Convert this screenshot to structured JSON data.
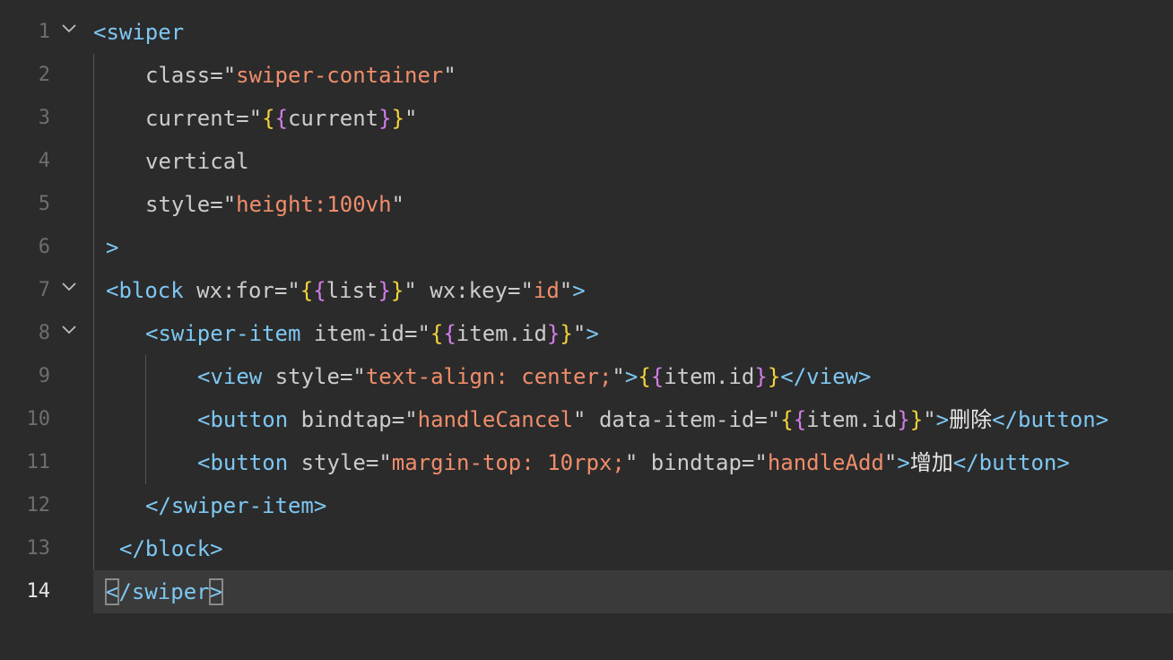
{
  "editor": {
    "active_line": 14,
    "lines": [
      {
        "no": "1",
        "tokens": [
          {
            "t": "<swiper",
            "c": "tag"
          }
        ]
      },
      {
        "no": "2",
        "tokens": [
          {
            "t": "class",
            "c": "attr"
          },
          {
            "t": "=",
            "c": "eq"
          },
          {
            "t": "\"",
            "c": "quote"
          },
          {
            "t": "swiper-container",
            "c": "str"
          },
          {
            "t": "\"",
            "c": "quote"
          }
        ]
      },
      {
        "no": "3",
        "tokens": [
          {
            "t": "current",
            "c": "attr"
          },
          {
            "t": "=",
            "c": "eq"
          },
          {
            "t": "\"",
            "c": "quote"
          },
          {
            "t": "{",
            "c": "brace-y"
          },
          {
            "t": "{",
            "c": "brace-p"
          },
          {
            "t": "current",
            "c": "var"
          },
          {
            "t": "}",
            "c": "brace-p"
          },
          {
            "t": "}",
            "c": "brace-y"
          },
          {
            "t": "\"",
            "c": "quote"
          }
        ]
      },
      {
        "no": "4",
        "tokens": [
          {
            "t": "vertical",
            "c": "attr"
          }
        ]
      },
      {
        "no": "5",
        "tokens": [
          {
            "t": "style",
            "c": "attr"
          },
          {
            "t": "=",
            "c": "eq"
          },
          {
            "t": "\"",
            "c": "quote"
          },
          {
            "t": "height:100vh",
            "c": "str"
          },
          {
            "t": "\"",
            "c": "quote"
          }
        ]
      },
      {
        "no": "6",
        "tokens": [
          {
            "t": ">",
            "c": "tag"
          }
        ]
      },
      {
        "no": "7",
        "tokens": [
          {
            "t": "<block",
            "c": "tag"
          },
          {
            "t": " wx:for",
            "c": "attr"
          },
          {
            "t": "=",
            "c": "eq"
          },
          {
            "t": "\"",
            "c": "quote"
          },
          {
            "t": "{",
            "c": "brace-y"
          },
          {
            "t": "{",
            "c": "brace-p"
          },
          {
            "t": "list",
            "c": "var"
          },
          {
            "t": "}",
            "c": "brace-p"
          },
          {
            "t": "}",
            "c": "brace-y"
          },
          {
            "t": "\"",
            "c": "quote"
          },
          {
            "t": " wx:key",
            "c": "attr"
          },
          {
            "t": "=",
            "c": "eq"
          },
          {
            "t": "\"",
            "c": "quote"
          },
          {
            "t": "id",
            "c": "str"
          },
          {
            "t": "\"",
            "c": "quote"
          },
          {
            "t": ">",
            "c": "tag"
          }
        ]
      },
      {
        "no": "8",
        "tokens": [
          {
            "t": "<swiper-item",
            "c": "tag"
          },
          {
            "t": " item-id",
            "c": "attr"
          },
          {
            "t": "=",
            "c": "eq"
          },
          {
            "t": "\"",
            "c": "quote"
          },
          {
            "t": "{",
            "c": "brace-y"
          },
          {
            "t": "{",
            "c": "brace-p"
          },
          {
            "t": "item.id",
            "c": "var"
          },
          {
            "t": "}",
            "c": "brace-p"
          },
          {
            "t": "}",
            "c": "brace-y"
          },
          {
            "t": "\"",
            "c": "quote"
          },
          {
            "t": ">",
            "c": "tag"
          }
        ]
      },
      {
        "no": "9",
        "tokens": [
          {
            "t": "<view",
            "c": "tag"
          },
          {
            "t": " style",
            "c": "attr"
          },
          {
            "t": "=",
            "c": "eq"
          },
          {
            "t": "\"",
            "c": "quote"
          },
          {
            "t": "text-align: center;",
            "c": "str"
          },
          {
            "t": "\"",
            "c": "quote"
          },
          {
            "t": ">",
            "c": "tag"
          },
          {
            "t": "{",
            "c": "brace-y"
          },
          {
            "t": "{",
            "c": "brace-p"
          },
          {
            "t": "item.id",
            "c": "var"
          },
          {
            "t": "}",
            "c": "brace-p"
          },
          {
            "t": "}",
            "c": "brace-y"
          },
          {
            "t": "</view>",
            "c": "tag"
          }
        ]
      },
      {
        "no": "10",
        "tokens": [
          {
            "t": "<button",
            "c": "tag"
          },
          {
            "t": " bindtap",
            "c": "attr"
          },
          {
            "t": "=",
            "c": "eq"
          },
          {
            "t": "\"",
            "c": "quote"
          },
          {
            "t": "handleCancel",
            "c": "str"
          },
          {
            "t": "\"",
            "c": "quote"
          },
          {
            "t": " data-item-id",
            "c": "attr"
          },
          {
            "t": "=",
            "c": "eq"
          },
          {
            "t": "\"",
            "c": "quote"
          },
          {
            "t": "{",
            "c": "brace-y"
          },
          {
            "t": "{",
            "c": "brace-p"
          },
          {
            "t": "item.id",
            "c": "var"
          },
          {
            "t": "}",
            "c": "brace-p"
          },
          {
            "t": "}",
            "c": "brace-y"
          },
          {
            "t": "\"",
            "c": "quote"
          },
          {
            "t": ">",
            "c": "tag"
          },
          {
            "t": "删除",
            "c": "text"
          },
          {
            "t": "</button>",
            "c": "tag"
          }
        ]
      },
      {
        "no": "11",
        "tokens": [
          {
            "t": "<button",
            "c": "tag"
          },
          {
            "t": " style",
            "c": "attr"
          },
          {
            "t": "=",
            "c": "eq"
          },
          {
            "t": "\"",
            "c": "quote"
          },
          {
            "t": "margin-top: 10rpx;",
            "c": "str"
          },
          {
            "t": "\"",
            "c": "quote"
          },
          {
            "t": " bindtap",
            "c": "attr"
          },
          {
            "t": "=",
            "c": "eq"
          },
          {
            "t": "\"",
            "c": "quote"
          },
          {
            "t": "handleAdd",
            "c": "str"
          },
          {
            "t": "\"",
            "c": "quote"
          },
          {
            "t": ">",
            "c": "tag"
          },
          {
            "t": "增加",
            "c": "text"
          },
          {
            "t": "</button>",
            "c": "tag"
          }
        ]
      },
      {
        "no": "12",
        "tokens": [
          {
            "t": "</swiper-item>",
            "c": "tag"
          }
        ]
      },
      {
        "no": "13",
        "tokens": [
          {
            "t": "</block>",
            "c": "tag"
          }
        ]
      },
      {
        "no": "14",
        "tokens": [
          {
            "t": "<",
            "c": "tag bracket-box"
          },
          {
            "t": "/swiper",
            "c": "tag"
          },
          {
            "t": ">",
            "c": "tag bracket-box"
          }
        ]
      }
    ]
  },
  "colors": {
    "background": "#2b2b2b",
    "active_line": "#3a3a3a",
    "tag": "#7ec7f2",
    "string": "#f08d6b",
    "brace_outer": "#f5d33a",
    "brace_inner": "#d17ee8"
  }
}
